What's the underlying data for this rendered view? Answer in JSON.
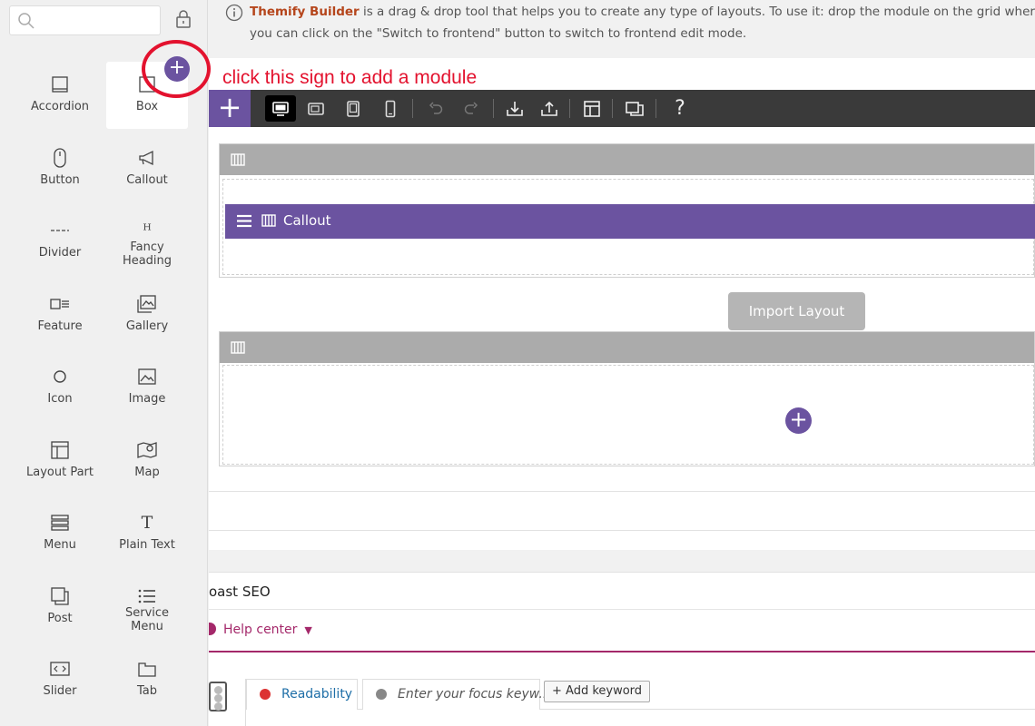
{
  "sidebar": {
    "search": {
      "value": "",
      "placeholder": ""
    },
    "modules": [
      {
        "label": "Accordion",
        "icon": "accordion-icon"
      },
      {
        "label": "Box",
        "icon": "box-icon"
      },
      {
        "label": "Button",
        "icon": "mouse-icon"
      },
      {
        "label": "Callout",
        "icon": "megaphone-icon"
      },
      {
        "label": "Divider",
        "icon": "divider-icon"
      },
      {
        "label": "Fancy Heading",
        "icon": "text-size-icon"
      },
      {
        "label": "Feature",
        "icon": "feature-icon"
      },
      {
        "label": "Gallery",
        "icon": "gallery-icon"
      },
      {
        "label": "Icon",
        "icon": "circle-icon"
      },
      {
        "label": "Image",
        "icon": "image-icon"
      },
      {
        "label": "Layout Part",
        "icon": "layout-icon"
      },
      {
        "label": "Map",
        "icon": "map-icon"
      },
      {
        "label": "Menu",
        "icon": "menu-icon"
      },
      {
        "label": "Plain Text",
        "icon": "text-icon"
      },
      {
        "label": "Post",
        "icon": "post-icon"
      },
      {
        "label": "Service Menu",
        "icon": "list-icon"
      },
      {
        "label": "Slider",
        "icon": "slider-icon"
      },
      {
        "label": "Tab",
        "icon": "tab-icon"
      }
    ],
    "add_symbol": "+"
  },
  "info": {
    "brand": "Themify Builder",
    "line1_rest": " is a drag & drop tool that helps you to create any type of layouts. To use it: drop the module on the grid where it says \"",
    "line2": "you can click on the \"Switch to frontend\" button to switch to frontend edit mode."
  },
  "annotation": "click this sign to add a module",
  "toolbar": {
    "add_symbol": "+",
    "help_symbol": "?"
  },
  "builder": {
    "callout_label": "Callout",
    "import_label": "Import Layout",
    "row_add_symbol": "+"
  },
  "seo": {
    "title": "oast SEO",
    "help_label": "Help center",
    "caret": "▼",
    "tabs": [
      {
        "label": "Readability",
        "dot_color": "#dc3232"
      },
      {
        "label": "Enter your focus keyw..",
        "dot_color": "#888888"
      }
    ],
    "add_keyword": "+ Add keyword"
  },
  "colors": {
    "accent": "#6b53a0",
    "annotation": "#e3122e",
    "brand": "#b5451b",
    "seo": "#a4286a"
  }
}
